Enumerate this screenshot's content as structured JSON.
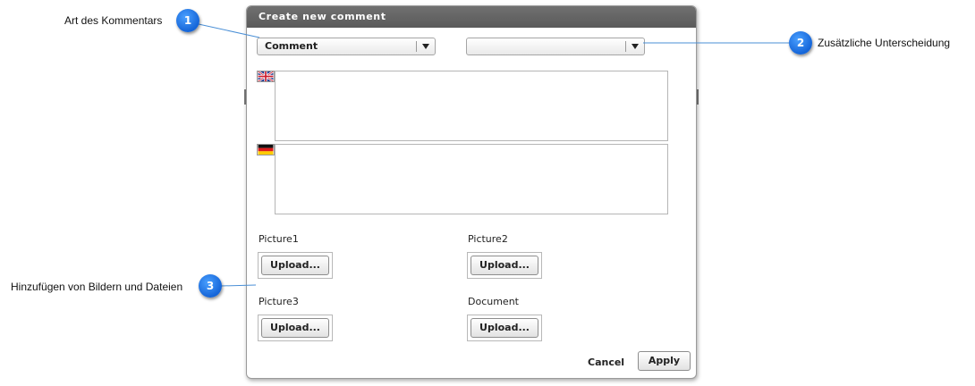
{
  "dialog": {
    "title": "Create new comment",
    "comment_type_select": {
      "value": "Comment"
    },
    "secondary_select": {
      "value": ""
    },
    "flags": [
      "flag-uk-icon",
      "flag-germany-icon"
    ],
    "uploads": [
      {
        "label": "Picture1",
        "button": "Upload..."
      },
      {
        "label": "Picture2",
        "button": "Upload..."
      },
      {
        "label": "Picture3",
        "button": "Upload..."
      },
      {
        "label": "Document",
        "button": "Upload..."
      }
    ],
    "cancel_label": "Cancel",
    "apply_label": "Apply"
  },
  "callouts": [
    {
      "number": "1",
      "text": "Art des Kommentars"
    },
    {
      "number": "2",
      "text": "Zusätzliche Unterscheidung"
    },
    {
      "number": "3",
      "text": "Hinzufügen von Bildern und Dateien"
    }
  ],
  "colors": {
    "titlebar": "#5f5f5f",
    "marker": "#1e73e8",
    "callout_line": "#4a8fd6"
  }
}
